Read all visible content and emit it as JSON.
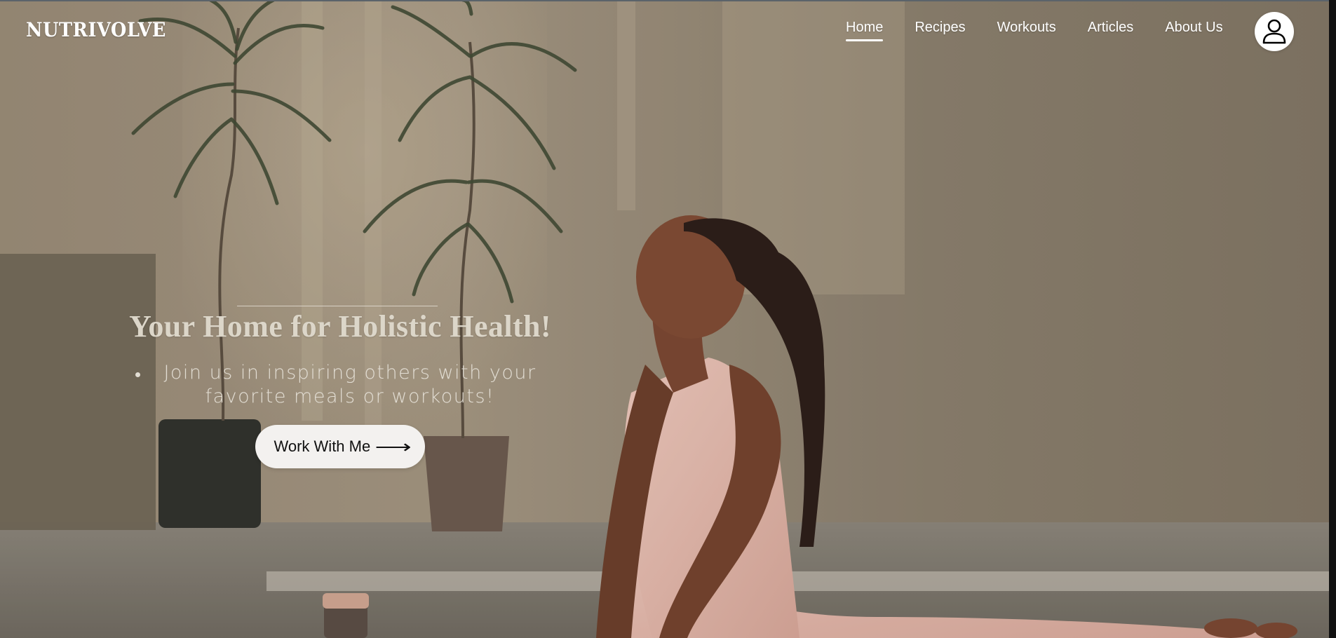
{
  "brand": {
    "name": "NUTRIVOLVE"
  },
  "nav": {
    "items": [
      {
        "label": "Home",
        "active": true
      },
      {
        "label": "Recipes",
        "active": false
      },
      {
        "label": "Workouts",
        "active": false
      },
      {
        "label": "Articles",
        "active": false
      },
      {
        "label": "About Us",
        "active": false
      }
    ],
    "profile_icon": "user-icon"
  },
  "hero": {
    "title": "Your Home for Holistic Health!",
    "bullets": [
      "Join us in inspiring others with your favorite meals or workouts!"
    ],
    "cta_label": "Work With Me",
    "cta_arrow": "⟶",
    "background_image": "woman doing cobra yoga pose in a sunlit room with potted plants"
  },
  "colors": {
    "nav_text": "#ffffff",
    "cta_background": "#f3f1ef",
    "title_text": "#dcd6c9"
  }
}
